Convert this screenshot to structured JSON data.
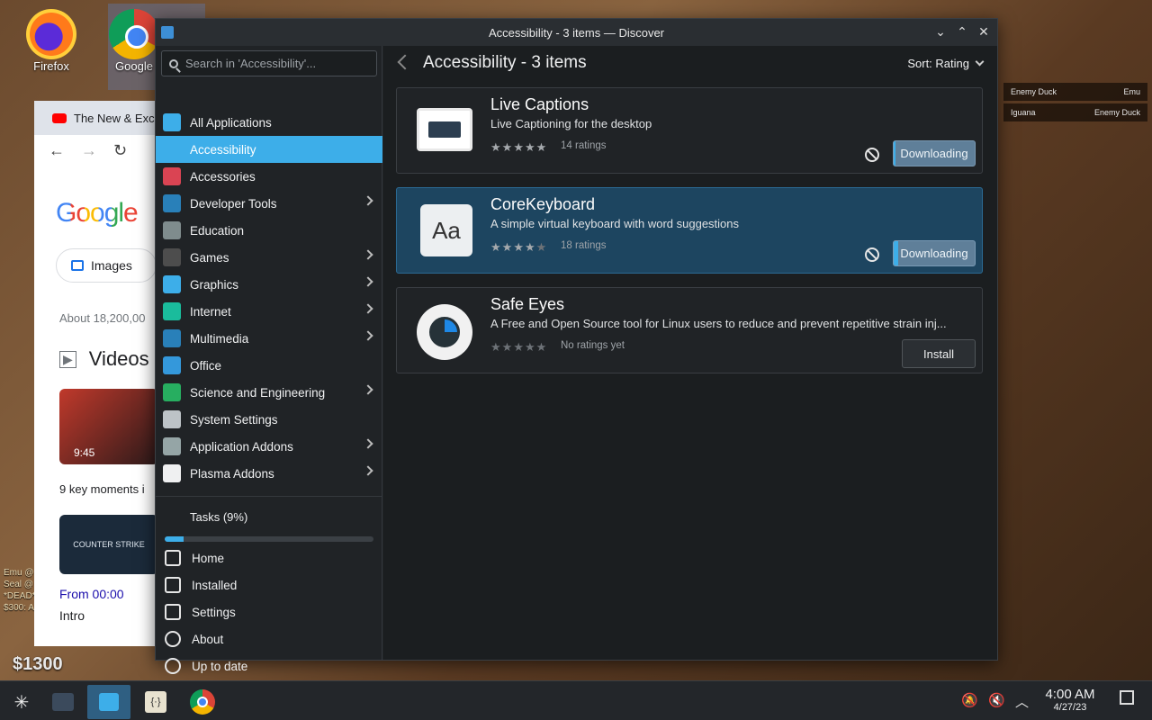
{
  "desktop": {
    "icons": [
      {
        "label": "Firefox"
      },
      {
        "label": "Google"
      }
    ],
    "hud": {
      "money": "$1300",
      "kill1_left": "Enemy Duck",
      "kill1_right": "Emu",
      "kill2_left": "Iguana",
      "kill2_right": "Enemy Duck",
      "left_feed": [
        "Emu @",
        "Seal @",
        "*DEAD*",
        "$300: A"
      ]
    }
  },
  "browser": {
    "tab_title": "The New & Exc",
    "logo": "Google",
    "images_chip": "Images",
    "about": "About 18,200,00",
    "videos_heading": "Videos",
    "video1_duration": "9:45",
    "key_moments": "9 key moments i",
    "video2_label": "COUNTER STRIKE",
    "from": "From 00:00",
    "intro": "Intro"
  },
  "window": {
    "title": "Accessibility - 3 items — Discover"
  },
  "search": {
    "placeholder": "Search in 'Accessibility'..."
  },
  "sidebar": {
    "categories": [
      {
        "label": "All Applications",
        "color": "#3daee9",
        "submenu": false
      },
      {
        "label": "Accessibility",
        "color": "#3daee9",
        "submenu": false,
        "selected": true
      },
      {
        "label": "Accessories",
        "color": "#da4453",
        "submenu": false
      },
      {
        "label": "Developer Tools",
        "color": "#2980b9",
        "submenu": true
      },
      {
        "label": "Education",
        "color": "#7f8c8d",
        "submenu": false
      },
      {
        "label": "Games",
        "color": "#4d4d4d",
        "submenu": true
      },
      {
        "label": "Graphics",
        "color": "#3daee9",
        "submenu": true
      },
      {
        "label": "Internet",
        "color": "#1abc9c",
        "submenu": true
      },
      {
        "label": "Multimedia",
        "color": "#2980b9",
        "submenu": true
      },
      {
        "label": "Office",
        "color": "#3498db",
        "submenu": false
      },
      {
        "label": "Science and Engineering",
        "color": "#27ae60",
        "submenu": true
      },
      {
        "label": "System Settings",
        "color": "#bdc3c7",
        "submenu": false
      },
      {
        "label": "Application Addons",
        "color": "#95a5a6",
        "submenu": true
      },
      {
        "label": "Plasma Addons",
        "color": "#eff0f1",
        "submenu": true
      }
    ],
    "tasks_label": "Tasks (9%)",
    "tasks_progress": 0.09,
    "bottom": [
      {
        "label": "Home",
        "icon": "home-icon"
      },
      {
        "label": "Installed",
        "icon": "installed-icon"
      },
      {
        "label": "Settings",
        "icon": "settings-icon"
      },
      {
        "label": "About",
        "icon": "info-icon"
      },
      {
        "label": "Up to date",
        "icon": "update-icon"
      }
    ]
  },
  "main": {
    "title": "Accessibility - 3 items",
    "sort_label": "Sort: Rating",
    "apps": [
      {
        "name": "Live Captions",
        "description": "Live Captioning for the desktop",
        "stars": 5,
        "ratings": "14 ratings",
        "action": "Downloading",
        "progress": 0.02
      },
      {
        "name": "CoreKeyboard",
        "description": "A simple virtual keyboard with word suggestions",
        "stars": 4,
        "ratings": "18 ratings",
        "action": "Downloading",
        "progress": 0.05
      },
      {
        "name": "Safe Eyes",
        "description": "A Free and Open Source tool for Linux users to reduce and prevent repetitive strain inj...",
        "stars": 0,
        "ratings": "No ratings yet",
        "action": "Install"
      }
    ]
  },
  "taskbar": {
    "time": "4:00 AM",
    "date": "4/27/23"
  }
}
